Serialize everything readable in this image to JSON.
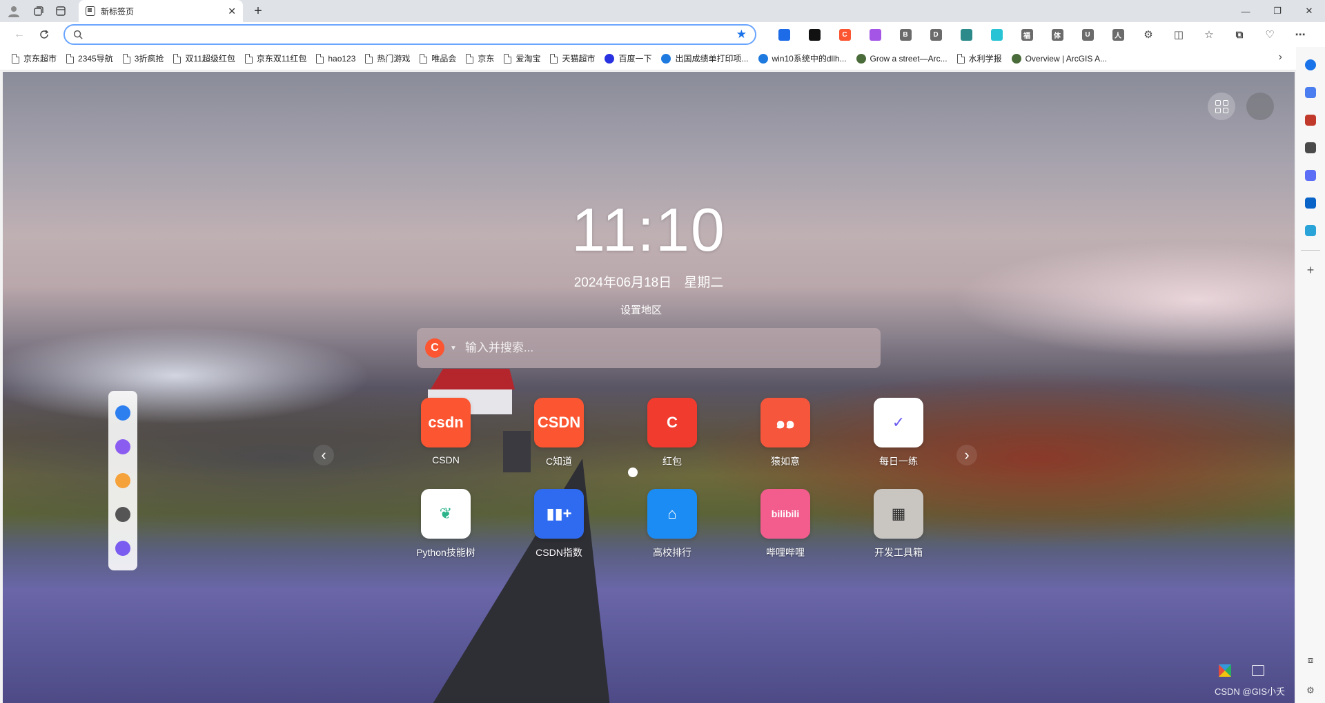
{
  "tab": {
    "title": "新标签页"
  },
  "omnibox": {
    "value": "",
    "placeholder": ""
  },
  "extensions": [
    {
      "name": "translate-ext",
      "letter": "",
      "color": "#1e6be8"
    },
    {
      "name": "grid-ext",
      "letter": "",
      "color": "#111111"
    },
    {
      "name": "csdn-ext",
      "letter": "C",
      "color": "#fc5531"
    },
    {
      "name": "brain-ext",
      "letter": "",
      "color": "#a455e6"
    },
    {
      "name": "b-ext",
      "letter": "B",
      "color": "#6b6b6b"
    },
    {
      "name": "d-ext",
      "letter": "D",
      "color": "#6b6b6b"
    },
    {
      "name": "gear-ext",
      "letter": "",
      "color": "#2d8a8a"
    },
    {
      "name": "q-ext",
      "letter": "",
      "color": "#28c3d4"
    },
    {
      "name": "fu-ext",
      "letter": "福",
      "color": "#6b6b6b"
    },
    {
      "name": "ti-ext",
      "letter": "体",
      "color": "#6b6b6b"
    },
    {
      "name": "u-ext",
      "letter": "U",
      "color": "#6b6b6b"
    },
    {
      "name": "ren-ext",
      "letter": "人",
      "color": "#6b6b6b"
    }
  ],
  "bookmarks": [
    {
      "label": "京东超市",
      "icon": "page"
    },
    {
      "label": "2345导航",
      "icon": "page"
    },
    {
      "label": "3折疯抢",
      "icon": "page"
    },
    {
      "label": "双11超级红包",
      "icon": "page"
    },
    {
      "label": "京东双11红包",
      "icon": "page"
    },
    {
      "label": "hao123",
      "icon": "page"
    },
    {
      "label": "热门游戏",
      "icon": "page"
    },
    {
      "label": "唯品会",
      "icon": "page"
    },
    {
      "label": "京东",
      "icon": "page"
    },
    {
      "label": "爱淘宝",
      "icon": "page"
    },
    {
      "label": "天猫超市",
      "icon": "page"
    },
    {
      "label": "百度一下",
      "icon": "baidu",
      "color": "#2932e1"
    },
    {
      "label": "出国成绩单打印项...",
      "icon": "site",
      "color": "#1f7ae0"
    },
    {
      "label": "win10系统中的dllh...",
      "icon": "shield",
      "color": "#1f7ae0"
    },
    {
      "label": "Grow a street—Arc...",
      "icon": "globe",
      "color": "#4a6b3a"
    },
    {
      "label": "水利学报",
      "icon": "page"
    },
    {
      "label": "Overview | ArcGIS A...",
      "icon": "globe",
      "color": "#4a6b3a"
    }
  ],
  "clock": {
    "time": "11:10"
  },
  "date": {
    "date": "2024年06月18日",
    "weekday": "星期二"
  },
  "region": {
    "label": "设置地区"
  },
  "search": {
    "engine_letter": "C",
    "placeholder": "输入并搜索..."
  },
  "tiles": [
    {
      "label": "CSDN",
      "icon_text": "csdn",
      "color": "#fc5531"
    },
    {
      "label": "C知道",
      "icon_text": "CSDN",
      "color": "#fc5531"
    },
    {
      "label": "红包",
      "icon_text": "C",
      "color": "#f13b2f"
    },
    {
      "label": "猿如意",
      "icon_text": "๑๑",
      "color": "#f5563c"
    },
    {
      "label": "每日一练",
      "icon_text": "✓",
      "color": "#ffffff"
    },
    {
      "label": "Python技能树",
      "icon_text": "❦",
      "color": "#ffffff"
    },
    {
      "label": "CSDN指数",
      "icon_text": "▮▮+",
      "color": "#2f6bf0"
    },
    {
      "label": "高校排行",
      "icon_text": "⌂",
      "color": "#1c8cf5"
    },
    {
      "label": "哔哩哔哩",
      "icon_text": "bilibili",
      "color": "#f25d8e"
    },
    {
      "label": "开发工具箱",
      "icon_text": "▦",
      "color": "#c9c6c2"
    }
  ],
  "dock": [
    {
      "name": "dock-app-1",
      "color": "#2d7ff0"
    },
    {
      "name": "dock-app-2",
      "color": "#8a5cf0"
    },
    {
      "name": "dock-app-3",
      "color": "#f5a23a"
    },
    {
      "name": "dock-app-4",
      "color": "#555555"
    },
    {
      "name": "dock-app-5",
      "color": "#7a5cf0"
    }
  ],
  "sidepanel": [
    {
      "name": "search-icon",
      "color": "#1a73e8"
    },
    {
      "name": "tag-icon",
      "color": "#4a7ef0"
    },
    {
      "name": "toolbox-icon",
      "color": "#c0392b"
    },
    {
      "name": "chess-icon",
      "color": "#4a4a4a"
    },
    {
      "name": "copilot-icon",
      "color": "#5b6ef5"
    },
    {
      "name": "outlook-icon",
      "color": "#0a64c8"
    },
    {
      "name": "send-icon",
      "color": "#2aa3d8"
    }
  ],
  "watermark": "CSDN @GIS小夭"
}
